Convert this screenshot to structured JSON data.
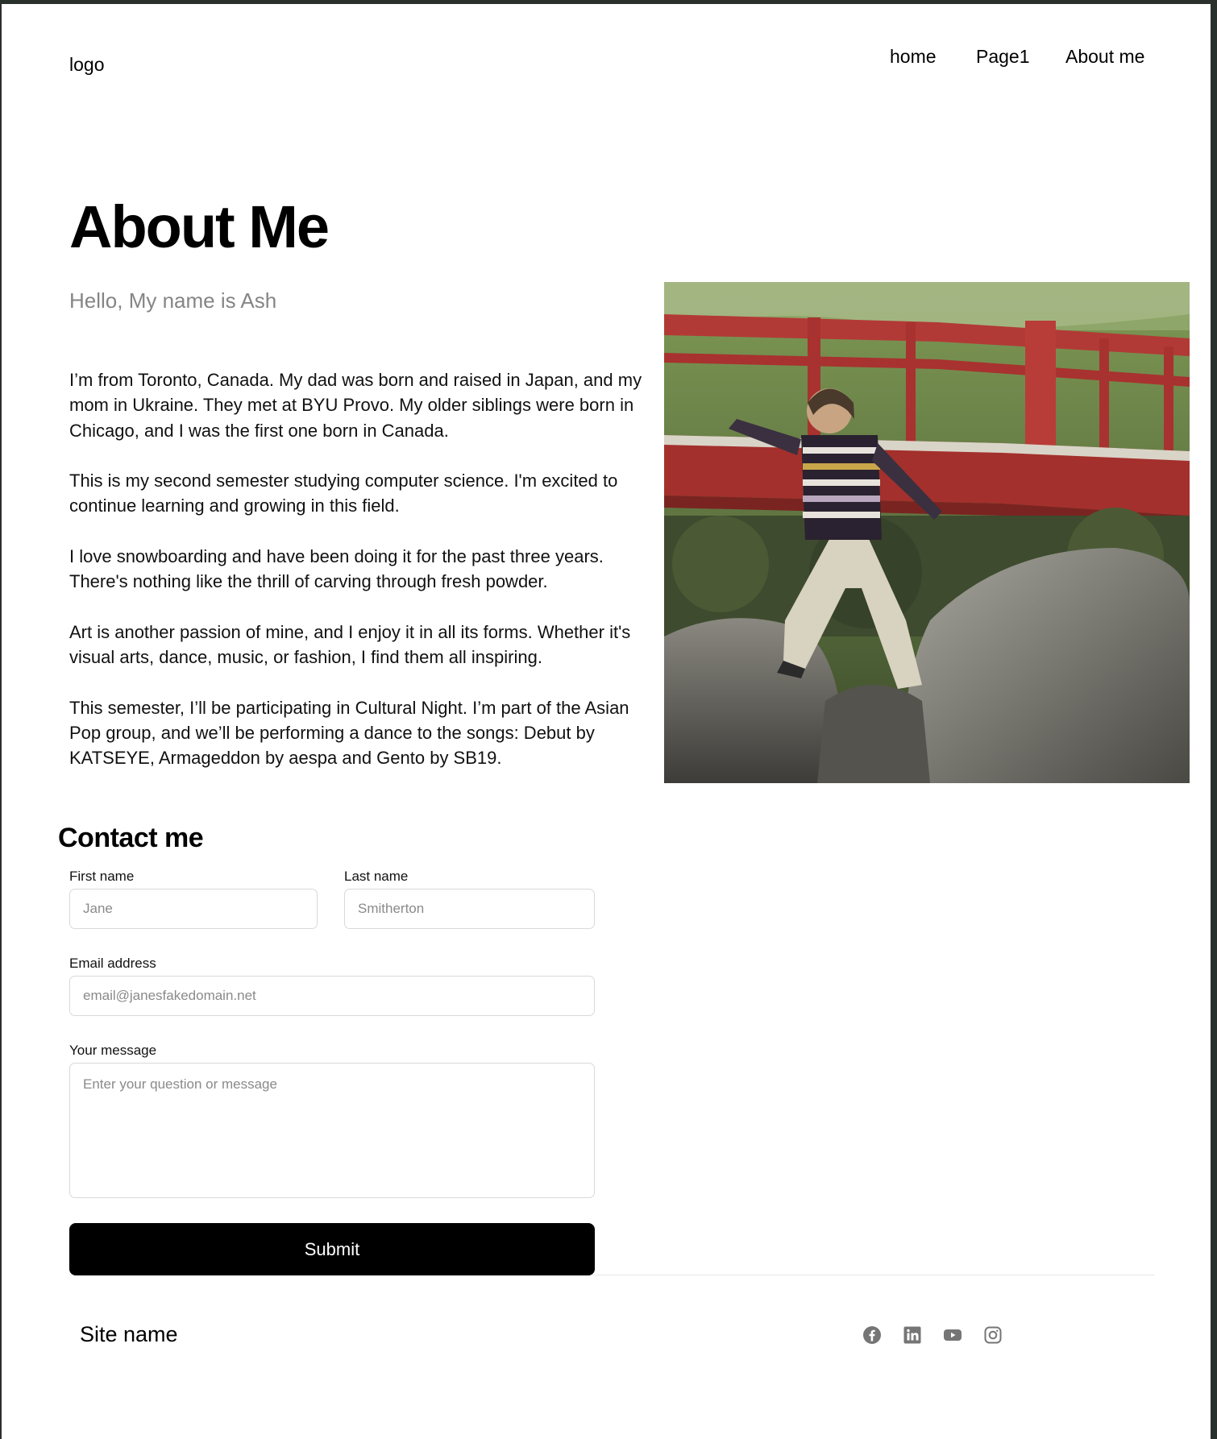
{
  "header": {
    "logo": "logo",
    "nav": [
      "home",
      "Page1",
      "About me"
    ]
  },
  "hero": {
    "title": "About Me",
    "subtitle": "Hello, My name is Ash",
    "paragraphs": [
      "I’m from Toronto, Canada. My dad was born and raised in Japan, and my mom in Ukraine. They met at BYU Provo. My older siblings were born in Chicago, and I was the first one born in Canada.",
      "This is my second semester studying computer science. I'm excited to continue learning and growing in this field.",
      "I love snowboarding and have been doing it for the past three years. There's nothing like the thrill of carving through fresh powder.",
      "Art is another passion of mine, and I enjoy it in all its forms. Whether it's visual arts, dance, music, or fashion, I find them all inspiring.",
      "This semester, I’ll be participating in Cultural Night. I’m part of the Asian Pop group, and we’ll be performing a dance to the songs: Debut by KATSEYE, Armageddon by aespa and Gento by SB19."
    ]
  },
  "contact": {
    "title": "Contact me",
    "first_name": {
      "label": "First name",
      "placeholder": "Jane",
      "value": ""
    },
    "last_name": {
      "label": "Last name",
      "placeholder": "Smitherton",
      "value": ""
    },
    "email": {
      "label": "Email address",
      "placeholder": "email@janesfakedomain.net",
      "value": ""
    },
    "message": {
      "label": "Your message",
      "placeholder": "Enter your question or message",
      "value": ""
    },
    "submit_label": "Submit"
  },
  "footer": {
    "site_name": "Site name",
    "social_icons": [
      "facebook-icon",
      "linkedin-icon",
      "youtube-icon",
      "instagram-icon"
    ],
    "icon_color": "#757575"
  },
  "colors": {
    "button_bg": "#000000",
    "button_text": "#ffffff",
    "subtitle": "#858585",
    "bridge": "#b23a36"
  }
}
